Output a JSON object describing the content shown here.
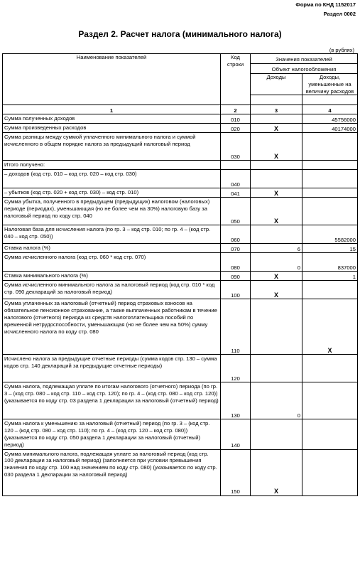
{
  "header": {
    "form_code": "Форма по КНД 1152017",
    "section_code": "Раздел 0002",
    "title": "Раздел 2. Расчет налога (минимального налога)",
    "units": "(в рублях)"
  },
  "columns": {
    "name": "Наименование показателей",
    "code": "Код строки",
    "values": "Значения показателей",
    "object": "Объект налогообложения",
    "income": "Доходы",
    "income_minus": "Доходы, уменьшенные на величину расходов",
    "n1": "1",
    "n2": "2",
    "n3": "3",
    "n4": "4"
  },
  "rows": [
    {
      "name": "Сумма полученных доходов",
      "code": "010",
      "c3": "",
      "c4": "45756000"
    },
    {
      "name": "Сумма произведенных расходов",
      "code": "020",
      "c3": "X",
      "c4": "40174000"
    },
    {
      "name": "Сумма разницы между суммой уплаченного минимального налога и суммой исчисленного в общем порядке налога за предыдущий налоговый период",
      "code": "030",
      "c3": "X",
      "c4": ""
    },
    {
      "name": "Итого получено:",
      "code": "",
      "c3": "",
      "c4": ""
    },
    {
      "name": "– доходов (код стр. 010 – код стр. 020 – код стр. 030)",
      "code": "040",
      "c3": "",
      "c4": ""
    },
    {
      "name": "– убытков (код стр. 020 + код стр. 030) – код стр. 010)",
      "code": "041",
      "c3": "X",
      "c4": ""
    },
    {
      "name": "Сумма убытка, полученного в предыдущем (предыдущих) налоговом (налоговых) периоде (периодах), уменьшающая (но не более чем на 30%) налоговую базу за налоговый период по коду стр. 040",
      "code": "050",
      "c3": "X",
      "c4": ""
    },
    {
      "name": "Налоговая база для исчисления налога (по гр. 3 – код стр. 010; по гр. 4 – (код стр. 040 – код стр. 050))",
      "code": "060",
      "c3": "",
      "c4": "5582000"
    },
    {
      "name": "Ставка налога (%)",
      "code": "070",
      "c3": "6",
      "c4": "15"
    },
    {
      "name": "Сумма исчисленного налога (код стр. 060 * код стр. 070)",
      "code": "080",
      "c3": "0",
      "c4": "837000"
    },
    {
      "name": "Ставка минимального налога (%)",
      "code": "090",
      "c3": "X",
      "c4": "1"
    },
    {
      "name": "Сумма исчисленного минимального налога за налоговый период (код стр. 010 * код стр. 090 деклараций за налоговый период)",
      "code": "100",
      "c3": "X",
      "c4": ""
    },
    {
      "name": "Сумма уплаченных за налоговый (отчетный) период страховых взносов на обязательное пенсионное страхование, а также выплаченных работникам в течение налогового (отчетного) периода из средств налогоплательщика пособий по временной нетрудоспособности, уменьшающая (но не более чем на 50%) сумму исчисленного налога по коду стр. 080",
      "code": "110",
      "c3": "",
      "c4": "X"
    },
    {
      "name": "Исчислено налога за предыдущие отчетные периоды (сумма кодов стр. 130 – сумма кодов стр. 140 деклараций за предыдущие отчетные периоды)",
      "code": "120",
      "c3": "",
      "c4": ""
    },
    {
      "name": "Сумма налога, подлежащая уплате по итогам налогового (отчетного) периода (по гр. 3 – (код стр. 080 – код стр. 110 – код стр. 120); по гр. 4 – (код стр. 080 – код стр. 120)) (указывается по коду стр. 03 раздела 1 декларации за налоговый (отчетный) период)",
      "code": "130",
      "c3": "0",
      "c4": ""
    },
    {
      "name": "Сумма налога к уменьшению за налоговый (отчетный) период (по гр. 3 – (код стр. 120 – (код стр. 080 – код стр. 110); по гр. 4 – (код стр. 120 – код стр. 080)) (указывается по коду стр. 050 раздела 1 декларации за налоговый (отчетный) период)",
      "code": "140",
      "c3": "",
      "c4": ""
    },
    {
      "name": "Сумма минимального налога, подлежащая уплате за налоговый период (код стр. 100 декларации за налоговый период) (заполняется при условии превышения значения по коду стр. 100 над значением по коду стр. 080) (указывается по коду стр. 030 раздела 1 декларации за налоговый период)",
      "code": "150",
      "c3": "X",
      "c4": ""
    }
  ]
}
